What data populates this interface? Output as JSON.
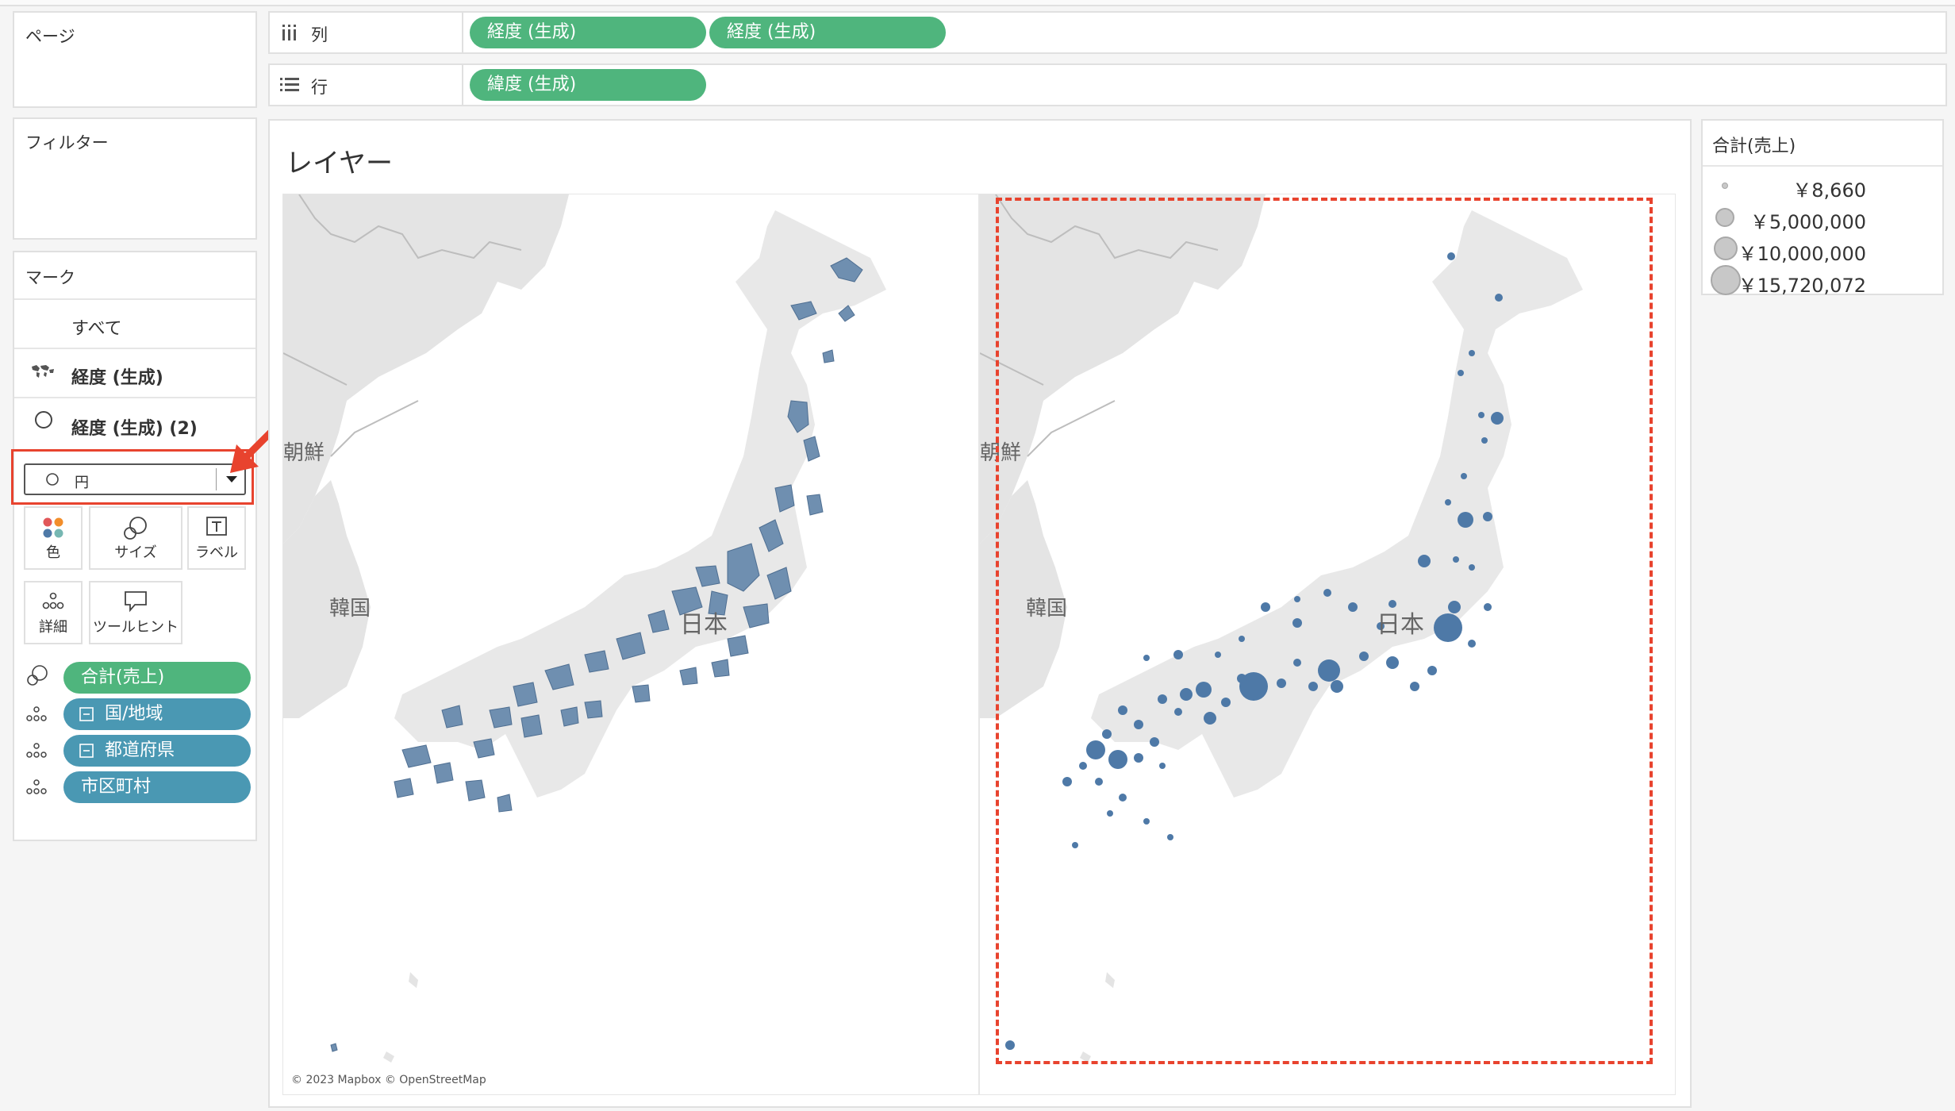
{
  "shelves": {
    "page_label": "ページ",
    "filter_label": "フィルター",
    "columns": {
      "label": "列",
      "pills": [
        "経度 (生成)",
        "経度 (生成)"
      ]
    },
    "rows": {
      "label": "行",
      "pills": [
        "緯度 (生成)"
      ]
    }
  },
  "marks": {
    "title": "マーク",
    "items": [
      {
        "label": "すべて",
        "icon": "none"
      },
      {
        "label": "経度 (生成)",
        "icon": "map-icon"
      },
      {
        "label": "経度 (生成) (2)",
        "icon": "circle-icon"
      }
    ],
    "mark_type": {
      "value": "円",
      "icon": "circle-icon"
    },
    "buttons": [
      {
        "label": "色",
        "icon": "color-icon"
      },
      {
        "label": "サイズ",
        "icon": "size-icon"
      },
      {
        "label": "ラベル",
        "icon": "label-icon"
      },
      {
        "label": "詳細",
        "icon": "detail-icon"
      },
      {
        "label": "ツールヒント",
        "icon": "tooltip-icon"
      }
    ],
    "fields": [
      {
        "label": "合計(売上)",
        "icon": "size-icon",
        "color": "#4fb57d"
      },
      {
        "label": "国/地域",
        "icon": "detail-icon",
        "color": "#4a98b3",
        "hier": true
      },
      {
        "label": "都道府県",
        "icon": "detail-icon",
        "color": "#4a98b3",
        "hier": true
      },
      {
        "label": "市区町村",
        "icon": "detail-icon",
        "color": "#4a98b3",
        "hier": false
      }
    ]
  },
  "view": {
    "title": "レイヤー",
    "map_labels": {
      "korea": "韓国",
      "japan": "日本",
      "chosen": "朝鮮"
    },
    "attribution": "© 2023 Mapbox © OpenStreetMap"
  },
  "legend": {
    "title": "合計(売上)",
    "entries": [
      "￥8,660",
      "￥5,000,000",
      "￥10,000,000",
      "￥15,720,072"
    ]
  },
  "colors": {
    "mark": "#4e79a7",
    "annotation": "#e8432e",
    "pill_green": "#4fb57d",
    "pill_blue": "#4a98b3"
  }
}
